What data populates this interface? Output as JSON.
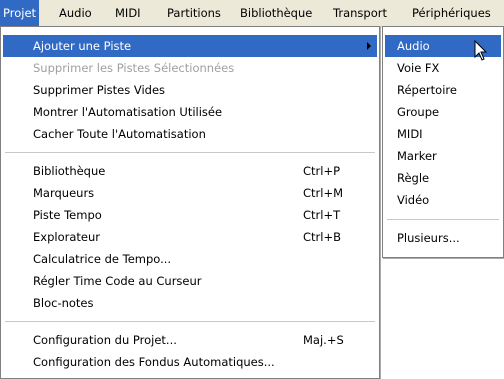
{
  "menubar": {
    "items": [
      {
        "label": "Projet"
      },
      {
        "label": "Audio"
      },
      {
        "label": "MIDI"
      },
      {
        "label": "Partitions"
      },
      {
        "label": "Bibliothèque"
      },
      {
        "label": "Transport"
      },
      {
        "label": "Périphériques"
      }
    ]
  },
  "menu": {
    "items": [
      {
        "label": "Ajouter une Piste"
      },
      {
        "label": "Supprimer les Pistes Sélectionnées"
      },
      {
        "label": "Supprimer Pistes Vides"
      },
      {
        "label": "Montrer l'Automatisation Utilisée"
      },
      {
        "label": "Cacher Toute l'Automatisation"
      },
      {
        "label": "Bibliothèque",
        "shortcut": "Ctrl+P"
      },
      {
        "label": "Marqueurs",
        "shortcut": "Ctrl+M"
      },
      {
        "label": "Piste Tempo",
        "shortcut": "Ctrl+T"
      },
      {
        "label": "Explorateur",
        "shortcut": "Ctrl+B"
      },
      {
        "label": "Calculatrice de Tempo..."
      },
      {
        "label": "Régler Time Code au Curseur"
      },
      {
        "label": "Bloc-notes"
      },
      {
        "label": "Configuration du Projet...",
        "shortcut": "Maj.+S"
      },
      {
        "label": "Configuration des Fondus Automatiques..."
      }
    ]
  },
  "submenu": {
    "items": [
      {
        "label": "Audio"
      },
      {
        "label": "Voie FX"
      },
      {
        "label": "Répertoire"
      },
      {
        "label": "Groupe"
      },
      {
        "label": "MIDI"
      },
      {
        "label": "Marker"
      },
      {
        "label": "Règle"
      },
      {
        "label": "Vidéo"
      },
      {
        "label": "Plusieurs..."
      }
    ]
  },
  "colors": {
    "highlight": "#316ac5",
    "menubar_bg": "#ece9d8",
    "disabled_text": "#a0a0a0"
  },
  "icons": {
    "submenu_arrow": "chevron-right-icon",
    "pointer": "mouse-cursor-icon"
  }
}
